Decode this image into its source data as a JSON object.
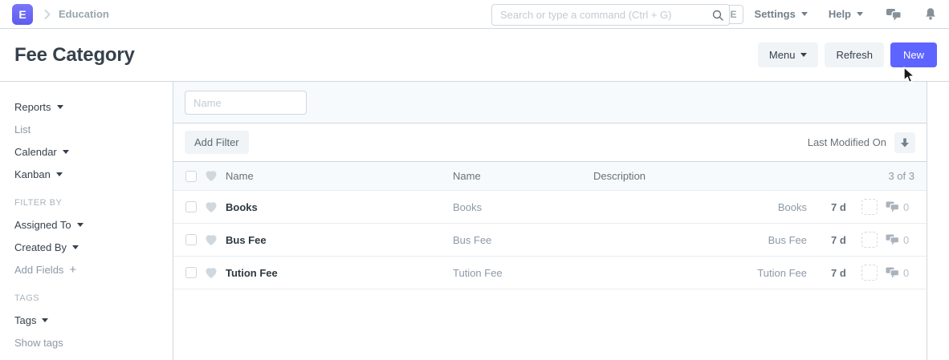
{
  "colors": {
    "primary": "#5e64ff",
    "text": "#36414c",
    "muted": "#8d99a6"
  },
  "navbar": {
    "logo_letter": "E",
    "breadcrumb": "Education",
    "search_placeholder": "Search or type a command (Ctrl + G)",
    "user_initial": "E",
    "settings_label": "Settings",
    "help_label": "Help"
  },
  "page_header": {
    "title": "Fee Category",
    "menu_label": "Menu",
    "refresh_label": "Refresh",
    "new_label": "New"
  },
  "sidebar": {
    "views": [
      {
        "label": "Reports"
      },
      {
        "label": "List"
      },
      {
        "label": "Calendar"
      },
      {
        "label": "Kanban"
      }
    ],
    "filter_by_heading": "FILTER BY",
    "assigned_to_label": "Assigned To",
    "created_by_label": "Created By",
    "add_fields_label": "Add Fields",
    "add_fields_icon": "+",
    "tags_heading": "TAGS",
    "tags_label": "Tags",
    "show_tags_label": "Show tags"
  },
  "filter_bar": {
    "name_placeholder": "Name",
    "add_filter_label": "Add Filter",
    "sort_label": "Last Modified On"
  },
  "list": {
    "header": {
      "subject": "Name",
      "name": "Name",
      "description": "Description",
      "count": "3 of 3"
    },
    "rows": [
      {
        "subject": "Books",
        "name": "Books",
        "description": "",
        "id": "Books",
        "modified": "7 d",
        "comments": "0"
      },
      {
        "subject": "Bus Fee",
        "name": "Bus Fee",
        "description": "",
        "id": "Bus Fee",
        "modified": "7 d",
        "comments": "0"
      },
      {
        "subject": "Tution Fee",
        "name": "Tution Fee",
        "description": "",
        "id": "Tution Fee",
        "modified": "7 d",
        "comments": "0"
      }
    ]
  }
}
